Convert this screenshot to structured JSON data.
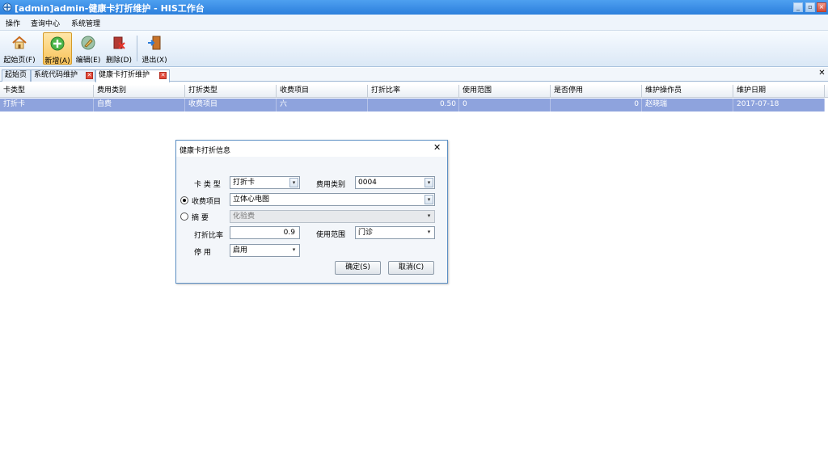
{
  "window": {
    "title": "[admin]admin-健康卡打折维护 - HIS工作台"
  },
  "menu": [
    "操作",
    "查询中心",
    "系统管理"
  ],
  "toolbar": {
    "home": "起始页(F)",
    "add": "新增(A)",
    "edit": "编辑(E)",
    "delete": "删除(D)",
    "exit": "退出(X)"
  },
  "tabs": [
    {
      "label": "起始页"
    },
    {
      "label": "系统代码维护"
    },
    {
      "label": "健康卡打折维护"
    }
  ],
  "grid": {
    "headers": [
      "卡类型",
      "费用类别",
      "打折类型",
      "收费项目",
      "打折比率",
      "使用范围",
      "是否停用",
      "维护操作员",
      "维护日期"
    ],
    "rows": [
      [
        "打折卡",
        "自费",
        "收费项目",
        "六",
        "0.50",
        "0",
        "0",
        "赵晓瑞",
        "2017-07-18"
      ]
    ]
  },
  "dialog": {
    "title": "健康卡打折信息",
    "card_type_label": "卡 类 型",
    "card_type_value": "打折卡",
    "fee_category_label": "费用类别",
    "fee_category_value": "0004",
    "charge_item_label": "收费项目",
    "charge_item_value": "立体心电图",
    "summary_label": "摘    要",
    "summary_value": "化验费",
    "discount_rate_label": "打折比率",
    "discount_rate_value": "0.9",
    "usage_range_label": "使用范围",
    "usage_range_value": "门诊",
    "status_label": "停    用",
    "status_value": "启用",
    "ok_label": "确定(S)",
    "cancel_label": "取消(C)"
  }
}
